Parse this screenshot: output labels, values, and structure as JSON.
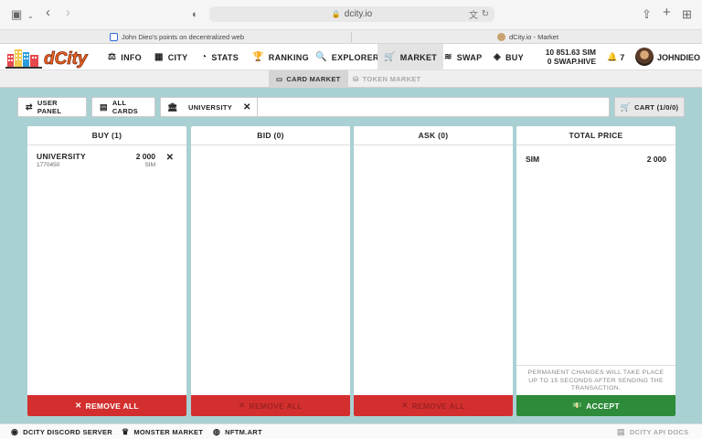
{
  "browser": {
    "url": "dcity.io",
    "tabs": [
      {
        "title": "John Dieo's points on decentralized web"
      },
      {
        "title": "dCity.io - Market"
      }
    ]
  },
  "app": {
    "logo_text": "dCity",
    "nav": [
      {
        "label": "INFO",
        "icon": "⚖"
      },
      {
        "label": "CITY",
        "icon": "▦"
      },
      {
        "label": "STATS",
        "icon": "◔"
      },
      {
        "label": "RANKING",
        "icon": "🏆"
      },
      {
        "label": "EXPLORER",
        "icon": "🔍"
      },
      {
        "label": "MARKET",
        "icon": "🛒"
      },
      {
        "label": "SWAP",
        "icon": "≋"
      },
      {
        "label": "BUY",
        "icon": "◈"
      }
    ],
    "balance_sim": "10 851.63 SIM",
    "balance_hive": "0 SWAP.HIVE",
    "notifications": "7",
    "username": "JOHNDIEO"
  },
  "subnav": {
    "card_market": "CARD MARKET",
    "token_market": "TOKEN MARKET"
  },
  "toolbar": {
    "user_panel": "USER PANEL",
    "all_cards": "ALL CARDS",
    "filter_value": "UNIVERSITY",
    "cart": "CART (1/0/0)"
  },
  "panels": {
    "buy": {
      "title": "BUY (1)",
      "items": [
        {
          "name": "UNIVERSITY",
          "id": "1770450",
          "price": "2 000",
          "unit": "SIM"
        }
      ],
      "footer": "REMOVE ALL"
    },
    "bid": {
      "title": "BID (0)",
      "footer": "REMOVE ALL"
    },
    "ask": {
      "title": "ASK (0)",
      "footer": "REMOVE ALL"
    },
    "total": {
      "title": "TOTAL PRICE",
      "currency": "SIM",
      "value": "2 000",
      "notice": "PERMANENT CHANGES WILL TAKE PLACE UP TO 15 SECONDS AFTER SENDING THE TRANSACTION.",
      "footer": "ACCEPT"
    }
  },
  "footer": {
    "discord": "DCITY DISCORD SERVER",
    "monster": "MONSTER MARKET",
    "nftm": "NFTM.ART",
    "api_docs": "DCITY API DOCS"
  },
  "colors": {
    "background": "#a9d0d3",
    "danger": "#d32f2f",
    "success": "#2e8b3a",
    "logo_orange": "#f26322"
  }
}
